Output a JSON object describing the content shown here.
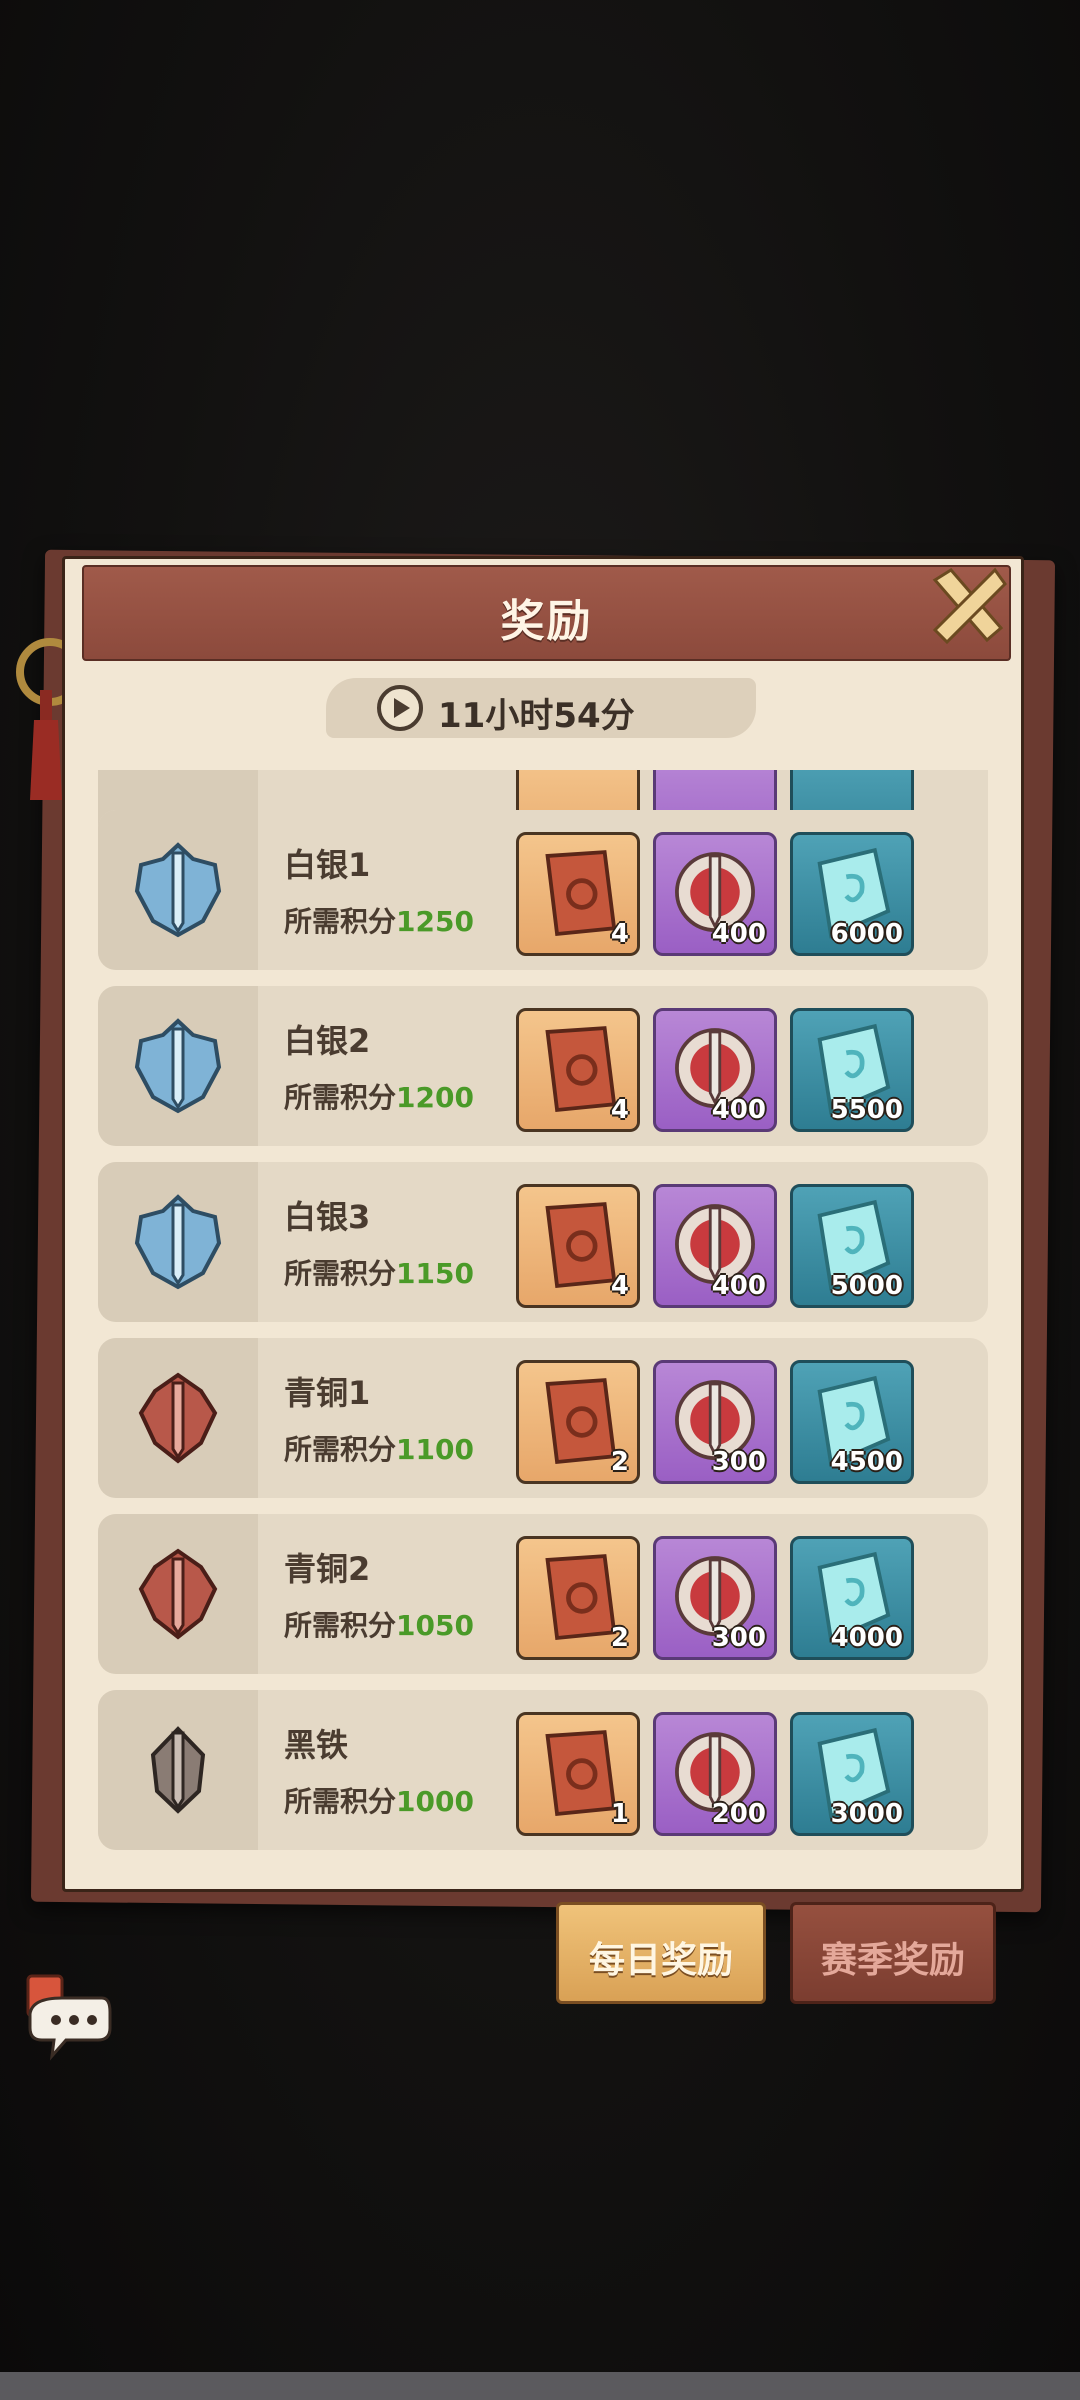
{
  "header": {
    "title": "奖励"
  },
  "timer": {
    "text": "11小时54分"
  },
  "req_label": "所需积分",
  "rows": [
    {
      "name": "白银1",
      "points": "1250",
      "tier": "silver",
      "rewards": [
        "4",
        "400",
        "6000"
      ]
    },
    {
      "name": "白银2",
      "points": "1200",
      "tier": "silver",
      "rewards": [
        "4",
        "400",
        "5500"
      ]
    },
    {
      "name": "白银3",
      "points": "1150",
      "tier": "silver",
      "rewards": [
        "4",
        "400",
        "5000"
      ]
    },
    {
      "name": "青铜1",
      "points": "1100",
      "tier": "bronze",
      "rewards": [
        "2",
        "300",
        "4500"
      ]
    },
    {
      "name": "青铜2",
      "points": "1050",
      "tier": "bronze",
      "rewards": [
        "2",
        "300",
        "4000"
      ]
    },
    {
      "name": "黑铁",
      "points": "1000",
      "tier": "iron",
      "rewards": [
        "1",
        "200",
        "3000"
      ]
    }
  ],
  "tabs": {
    "daily": "每日奖励",
    "season": "赛季奖励"
  },
  "colors": {
    "points_green": "#4a9a28",
    "header_red": "#8c4a3c",
    "panel_bg": "#f2e7d4"
  }
}
